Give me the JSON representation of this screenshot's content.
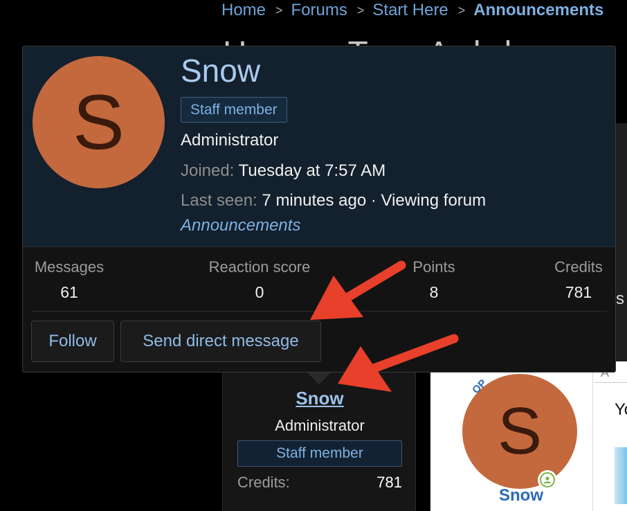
{
  "breadcrumb": {
    "items": [
      "Home",
      "Forums",
      "Start Here",
      "Announcements"
    ]
  },
  "background": {
    "page_title_fragment": "How To Add Your YouTube",
    "right_fragment": "s"
  },
  "profile_card": {
    "avatar_letter": "S",
    "username": "Snow",
    "badge": "Staff member",
    "role": "Administrator",
    "joined_label": "Joined:",
    "joined_value": "Tuesday at 7:57 AM",
    "last_seen_label": "Last seen:",
    "last_seen_value": "7 minutes ago · Viewing forum",
    "last_seen_link": "Announcements",
    "stats": [
      {
        "label": "Messages",
        "value": "61"
      },
      {
        "label": "Reaction score",
        "value": "0"
      },
      {
        "label": "Points",
        "value": "8"
      },
      {
        "label": "Credits",
        "value": "781"
      }
    ],
    "follow_label": "Follow",
    "dm_label": "Send direct message"
  },
  "post_author": {
    "username": "Snow",
    "role": "Administrator",
    "badge": "Staff member",
    "credits_label": "Credits:",
    "credits_value": "781"
  },
  "post": {
    "op_badge": "OP",
    "avatar_letter": "S",
    "username": "Snow",
    "header_fragment": "A",
    "text_fragment": "Yo"
  },
  "colors": {
    "accent_link": "#7eb0e2",
    "avatar_bg": "#c3693d",
    "annotation_arrow": "#e8402a",
    "online": "#7cb342"
  },
  "icons": {
    "separator": "chevron-right-icon",
    "online": "user-online-icon",
    "annotation": "red-arrow-annotation"
  }
}
